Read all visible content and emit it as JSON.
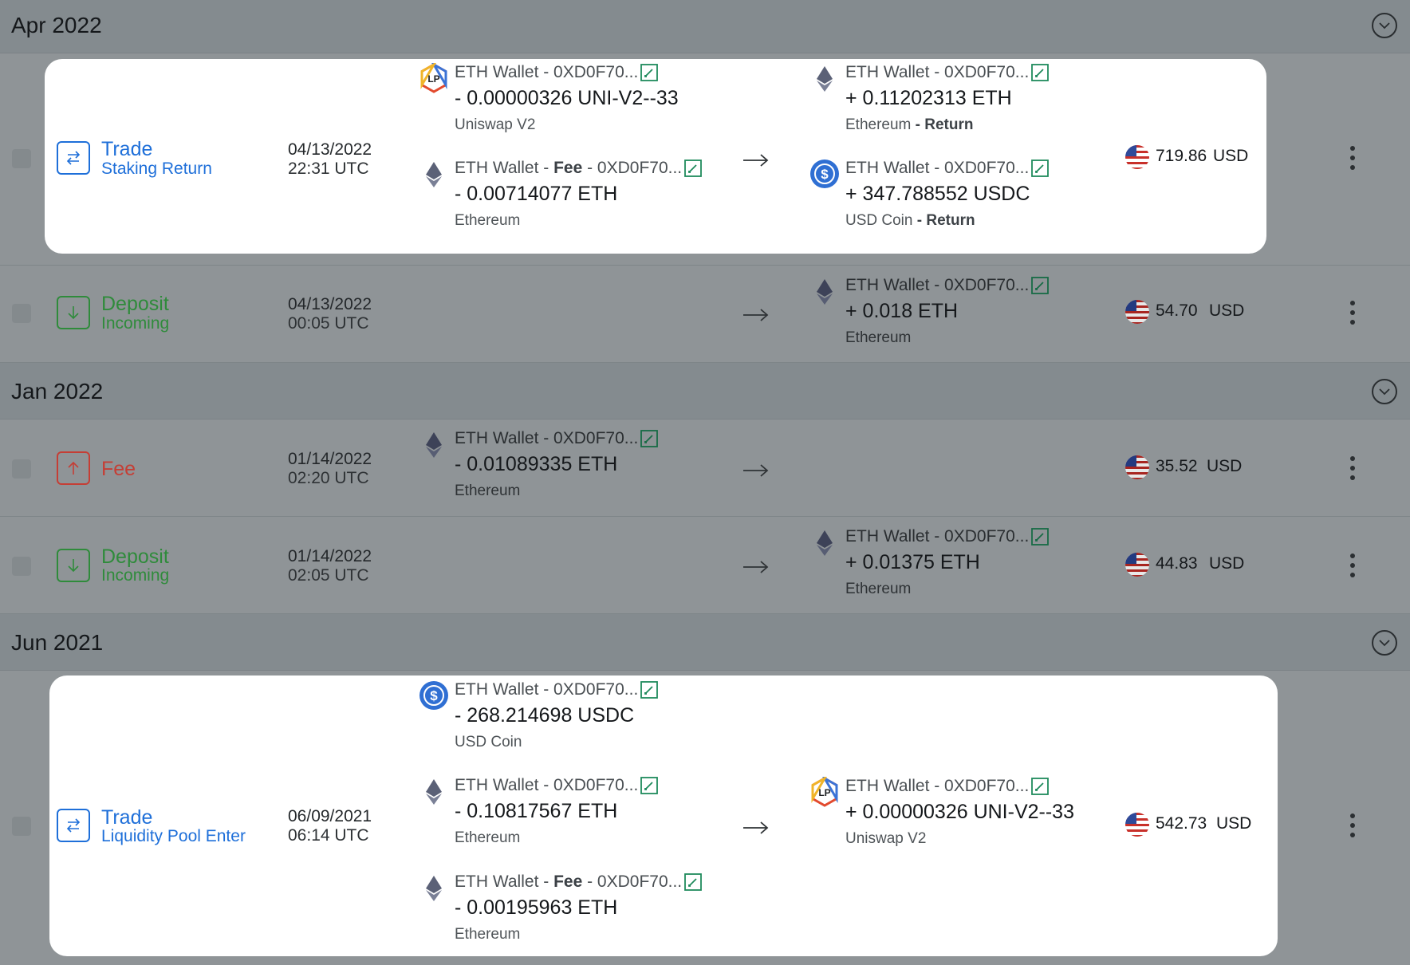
{
  "groups": [
    {
      "month": "Apr 2022"
    },
    {
      "month": "Jan 2022"
    },
    {
      "month": "Jun 2021"
    }
  ],
  "tx": [
    {
      "type": "Trade",
      "subtype": "Staking Return",
      "date": "04/13/2022",
      "time": "22:31 UTC",
      "out": [
        {
          "logo": "lp-logo",
          "wallet": "ETH Wallet - 0XD0F70...",
          "amount": "- 0.00000326 UNI-V2--33",
          "network": "Uniswap V2"
        },
        {
          "logo": "eth-logo",
          "wallet_prefix": "ETH Wallet - ",
          "fee": "Fee",
          "wallet_suffix": " - 0XD0F70...",
          "amount": "- 0.00714077 ETH",
          "network": "Ethereum"
        }
      ],
      "in": [
        {
          "logo": "eth-logo",
          "wallet": "ETH Wallet - 0XD0F70...",
          "amount": "+ 0.11202313 ETH",
          "network": "Ethereum",
          "tag": "Return"
        },
        {
          "logo": "usdc-logo",
          "wallet": "ETH Wallet - 0XD0F70...",
          "amount": "+ 347.788552 USDC",
          "network": "USD Coin",
          "tag": "Return"
        }
      ],
      "value": "719.86",
      "currency": "USD"
    },
    {
      "type": "Deposit",
      "subtype": "Incoming",
      "date": "04/13/2022",
      "time": "00:05 UTC",
      "in": [
        {
          "logo": "eth-logo",
          "wallet": "ETH Wallet - 0XD0F70...",
          "amount": "+ 0.018 ETH",
          "network": "Ethereum"
        }
      ],
      "value": "54.70",
      "currency": "USD"
    },
    {
      "type": "Fee",
      "date": "01/14/2022",
      "time": "02:20 UTC",
      "out": [
        {
          "logo": "eth-logo",
          "wallet": "ETH Wallet - 0XD0F70...",
          "amount": "- 0.01089335 ETH",
          "network": "Ethereum"
        }
      ],
      "value": "35.52",
      "currency": "USD"
    },
    {
      "type": "Deposit",
      "subtype": "Incoming",
      "date": "01/14/2022",
      "time": "02:05 UTC",
      "in": [
        {
          "logo": "eth-logo",
          "wallet": "ETH Wallet - 0XD0F70...",
          "amount": "+ 0.01375 ETH",
          "network": "Ethereum"
        }
      ],
      "value": "44.83",
      "currency": "USD"
    },
    {
      "type": "Trade",
      "subtype": "Liquidity Pool Enter",
      "date": "06/09/2021",
      "time": "06:14 UTC",
      "out": [
        {
          "logo": "usdc-logo",
          "wallet": "ETH Wallet - 0XD0F70...",
          "amount": "- 268.214698 USDC",
          "network": "USD Coin"
        },
        {
          "logo": "eth-logo",
          "wallet": "ETH Wallet - 0XD0F70...",
          "amount": "- 0.10817567 ETH",
          "network": "Ethereum"
        },
        {
          "logo": "eth-logo",
          "wallet_prefix": "ETH Wallet - ",
          "fee": "Fee",
          "wallet_suffix": " - 0XD0F70...",
          "amount": "- 0.00195963 ETH",
          "network": "Ethereum"
        }
      ],
      "in": [
        {
          "logo": "lp-logo",
          "wallet": "ETH Wallet - 0XD0F70...",
          "amount": "+ 0.00000326 UNI-V2--33",
          "network": "Uniswap V2"
        }
      ],
      "value": "542.73",
      "currency": "USD"
    }
  ],
  "network_tag_separator": " - ",
  "colors": {
    "accent_blue": "#1e6fd9",
    "deposit_green": "#1f8a2c",
    "fee_red": "#cf3025"
  }
}
